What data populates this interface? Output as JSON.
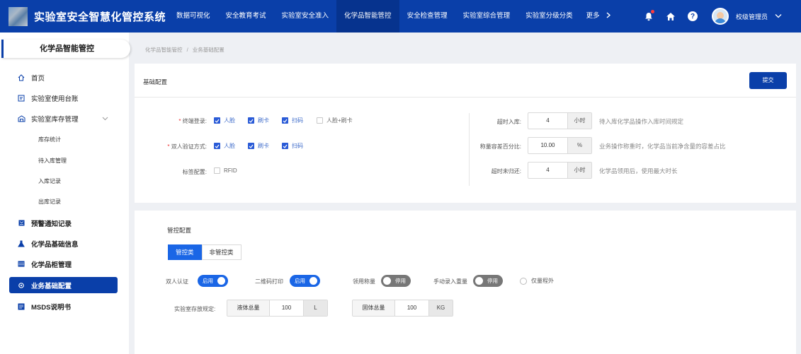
{
  "app": {
    "title": "实验室安全智慧化管控系统"
  },
  "nav": {
    "items": [
      "数据可视化",
      "安全教育考试",
      "实验室安全准入",
      "化学品智能管控",
      "安全检查管理",
      "实验室综合管理",
      "实验室分级分类"
    ],
    "active": 3,
    "more": "更多"
  },
  "user": {
    "name": "校级管理员"
  },
  "sidebar": {
    "header": "化学品智能管控",
    "items": {
      "home": "首页",
      "ledger": "实验室使用台账",
      "inventory": "实验室库存管理",
      "stock_stats": "库存统计",
      "pending_in": "待入库管理",
      "in_records": "入库记录",
      "out_records": "出库记录",
      "alerts": "预警通知记录",
      "chem_info": "化学品基础信息",
      "cabinet": "化学品柜管理",
      "biz_config": "业务基础配置",
      "msds": "MSDS说明书"
    }
  },
  "breadcrumb": {
    "root": "化学品智能管控",
    "sep": "/",
    "current": "业务基础配置"
  },
  "basic_config": {
    "title": "基础配置",
    "submit": "提交",
    "terminal_login": {
      "label": "终端登录:",
      "options": [
        {
          "label": "人脸",
          "checked": true
        },
        {
          "label": "刷卡",
          "checked": true
        },
        {
          "label": "扫码",
          "checked": true
        },
        {
          "label": "人脸+刷卡",
          "checked": false
        }
      ]
    },
    "dual_verify": {
      "label": "双人验证方式:",
      "options": [
        {
          "label": "人脸",
          "checked": true
        },
        {
          "label": "刷卡",
          "checked": true
        },
        {
          "label": "扫码",
          "checked": true
        }
      ]
    },
    "tag_config": {
      "label": "标签配置:",
      "options": [
        {
          "label": "RFID",
          "checked": false
        }
      ]
    },
    "timeout_in": {
      "label": "超时入库:",
      "value": "4",
      "unit": "小时",
      "hint": "待入库化学品操作入库时间规定"
    },
    "weigh_diff": {
      "label": "称量容差百分比:",
      "value": "10.00",
      "unit": "%",
      "hint": "业务操作称重时，化学品当前净含量的容差占比"
    },
    "timeout_return": {
      "label": "超时未归还:",
      "value": "4",
      "unit": "小时",
      "hint": "化学品领用后，使用最大时长"
    }
  },
  "control_config": {
    "title": "管控配置",
    "tabs": [
      "管控类",
      "非管控类"
    ],
    "active_tab": 0,
    "toggles": [
      {
        "label": "双人认证",
        "state": "启用",
        "on": true
      },
      {
        "label": "二维码打印",
        "state": "启用",
        "on": true
      },
      {
        "label": "领用称量",
        "state": "停用",
        "on": false
      },
      {
        "label": "手动录入重量",
        "state": "停用",
        "on": false
      }
    ],
    "radio": {
      "label": "仅量程外",
      "checked": false
    },
    "storage_rule": {
      "label": "实验室存放规定:",
      "liquid": {
        "prefix": "液体总量",
        "value": "100",
        "unit": "L"
      },
      "solid": {
        "prefix": "固体总量",
        "value": "100",
        "unit": "KG"
      }
    }
  }
}
